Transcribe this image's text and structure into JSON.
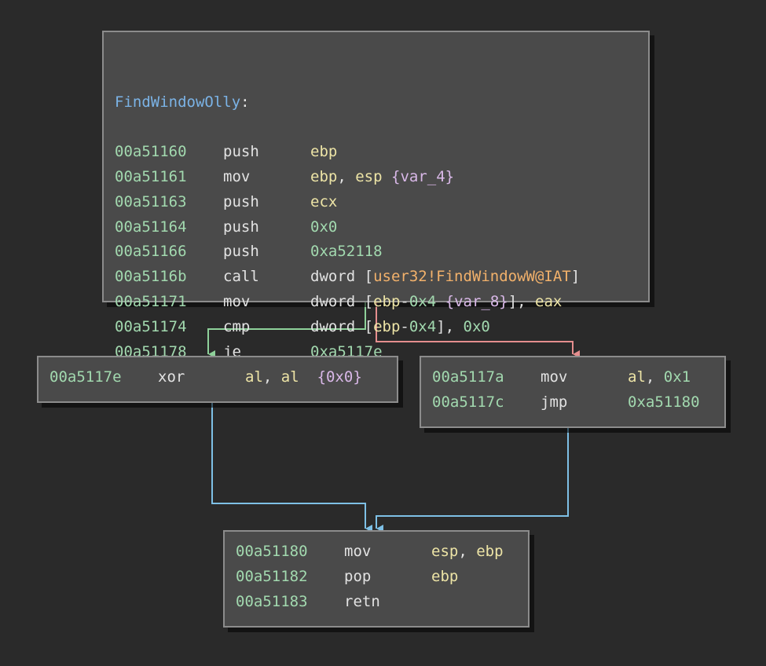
{
  "colors": {
    "background": "#2a2a2a",
    "block_bg": "#4a4a4a",
    "block_border": "#8c8c8c",
    "address": "#a2d9af",
    "label": "#7bb3e6",
    "register": "#ede4a6",
    "number": "#a2d9af",
    "variable": "#d9b8e8",
    "import_symbol": "#f2b16b",
    "edge_true": "#8ed19a",
    "edge_false": "#e58e8e",
    "edge_unconditional": "#7ec0e6"
  },
  "blocks": {
    "entry": {
      "label": "FindWindowOlly",
      "label_suffix": ":",
      "lines": [
        {
          "addr": "00a51160",
          "mnemonic": "push",
          "operands": [
            {
              "t": "reg",
              "v": "ebp"
            }
          ]
        },
        {
          "addr": "00a51161",
          "mnemonic": "mov",
          "operands": [
            {
              "t": "reg",
              "v": "ebp"
            },
            {
              "t": "plain",
              "v": ", "
            },
            {
              "t": "reg",
              "v": "esp"
            },
            {
              "t": "plain",
              "v": " "
            },
            {
              "t": "var",
              "v": "{var_4}"
            }
          ]
        },
        {
          "addr": "00a51163",
          "mnemonic": "push",
          "operands": [
            {
              "t": "reg",
              "v": "ecx"
            }
          ]
        },
        {
          "addr": "00a51164",
          "mnemonic": "push",
          "operands": [
            {
              "t": "num",
              "v": "0x0"
            }
          ]
        },
        {
          "addr": "00a51166",
          "mnemonic": "push",
          "operands": [
            {
              "t": "num",
              "v": "0xa52118"
            }
          ]
        },
        {
          "addr": "00a5116b",
          "mnemonic": "call",
          "operands": [
            {
              "t": "plain",
              "v": "dword ["
            },
            {
              "t": "sym",
              "v": "user32!FindWindowW@IAT"
            },
            {
              "t": "plain",
              "v": "]"
            }
          ]
        },
        {
          "addr": "00a51171",
          "mnemonic": "mov",
          "operands": [
            {
              "t": "plain",
              "v": "dword ["
            },
            {
              "t": "reg",
              "v": "ebp"
            },
            {
              "t": "plain",
              "v": "-"
            },
            {
              "t": "num",
              "v": "0x4"
            },
            {
              "t": "plain",
              "v": " "
            },
            {
              "t": "var",
              "v": "{var_8}"
            },
            {
              "t": "plain",
              "v": "], "
            },
            {
              "t": "reg",
              "v": "eax"
            }
          ]
        },
        {
          "addr": "00a51174",
          "mnemonic": "cmp",
          "operands": [
            {
              "t": "plain",
              "v": "dword ["
            },
            {
              "t": "reg",
              "v": "ebp"
            },
            {
              "t": "plain",
              "v": "-"
            },
            {
              "t": "num",
              "v": "0x4"
            },
            {
              "t": "plain",
              "v": "], "
            },
            {
              "t": "num",
              "v": "0x0"
            }
          ]
        },
        {
          "addr": "00a51178",
          "mnemonic": "je",
          "operands": [
            {
              "t": "num",
              "v": "0xa5117e"
            }
          ]
        }
      ]
    },
    "true_branch": {
      "lines": [
        {
          "addr": "00a5117e",
          "mnemonic": "xor",
          "operands": [
            {
              "t": "reg",
              "v": "al"
            },
            {
              "t": "plain",
              "v": ", "
            },
            {
              "t": "reg",
              "v": "al"
            },
            {
              "t": "plain",
              "v": "  "
            },
            {
              "t": "var",
              "v": "{0x0}"
            }
          ]
        }
      ]
    },
    "false_branch": {
      "lines": [
        {
          "addr": "00a5117a",
          "mnemonic": "mov",
          "operands": [
            {
              "t": "reg",
              "v": "al"
            },
            {
              "t": "plain",
              "v": ", "
            },
            {
              "t": "num",
              "v": "0x1"
            }
          ]
        },
        {
          "addr": "00a5117c",
          "mnemonic": "jmp",
          "operands": [
            {
              "t": "num",
              "v": "0xa51180"
            }
          ]
        }
      ]
    },
    "exit": {
      "lines": [
        {
          "addr": "00a51180",
          "mnemonic": "mov",
          "operands": [
            {
              "t": "reg",
              "v": "esp"
            },
            {
              "t": "plain",
              "v": ", "
            },
            {
              "t": "reg",
              "v": "ebp"
            }
          ]
        },
        {
          "addr": "00a51182",
          "mnemonic": "pop",
          "operands": [
            {
              "t": "reg",
              "v": "ebp"
            }
          ]
        },
        {
          "addr": "00a51183",
          "mnemonic": "retn",
          "operands": []
        }
      ]
    }
  }
}
